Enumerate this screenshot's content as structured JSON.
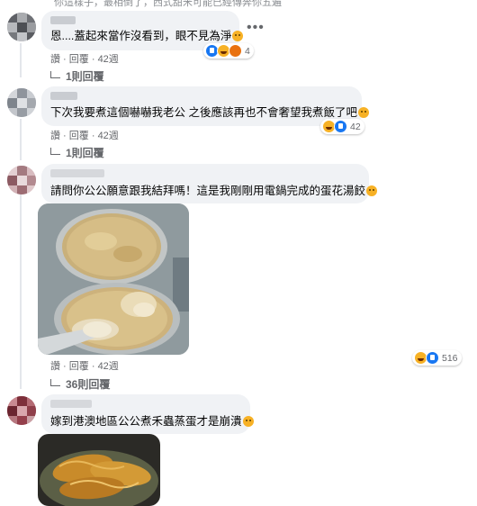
{
  "top_text": "你這樣子，最相倒了，西式甜米可能已經傳奔你五遍",
  "comments": [
    {
      "text": "恩....蓋起來當作沒看到，眼不見為淨",
      "reaction_count": "4",
      "actions": {
        "like": "讚",
        "reply": "回覆",
        "time": "42週"
      },
      "replies": "1則回覆"
    },
    {
      "text": "下次我要煮這個嚇嚇我老公 之後應該再也不會奢望我煮飯了吧",
      "reaction_count": "42",
      "actions": {
        "like": "讚",
        "reply": "回覆",
        "time": "42週"
      },
      "replies": "1則回覆"
    },
    {
      "text": "請問你公公願意跟我結拜嗎！這是我剛剛用電鍋完成的蛋花湯餃",
      "reaction_count": "516",
      "actions": {
        "like": "讚",
        "reply": "回覆",
        "time": "42週"
      },
      "replies": "36則回覆"
    },
    {
      "text": "嫁到港澳地區公公煮禾蟲蒸蛋才是崩潰"
    }
  ],
  "icons": {
    "more": "more-options-icon",
    "reply_arrow": "reply-arrow-icon"
  },
  "colors": {
    "bubble": "#f0f2f5",
    "meta": "#65676b",
    "like_blue": "#1877f2",
    "haha_yellow": "#f7b125"
  }
}
